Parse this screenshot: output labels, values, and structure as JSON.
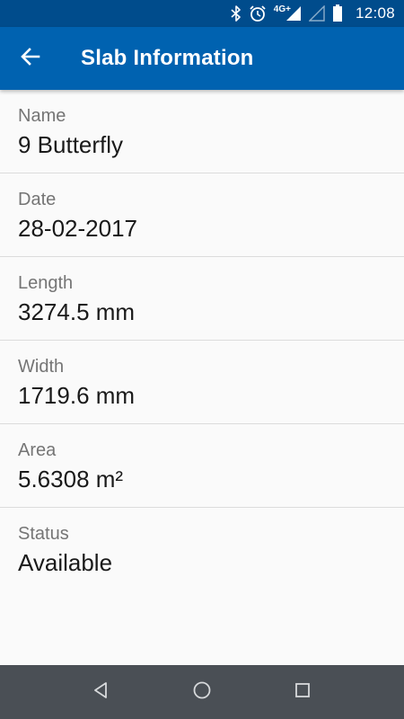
{
  "status_bar": {
    "network_type": "4G+",
    "time": "12:08",
    "icons": [
      "bluetooth-icon",
      "alarm-icon",
      "signal-icon",
      "signal-empty-icon",
      "battery-icon"
    ]
  },
  "app_bar": {
    "title": "Slab Information",
    "back_icon": "arrow-back-icon"
  },
  "fields": [
    {
      "label": "Name",
      "value": "9 Butterfly"
    },
    {
      "label": "Date",
      "value": "28-02-2017"
    },
    {
      "label": "Length",
      "value": "3274.5 mm"
    },
    {
      "label": "Width",
      "value": "1719.6 mm"
    },
    {
      "label": "Area",
      "value": "5.6308 m²"
    },
    {
      "label": "Status",
      "value": "Available"
    }
  ],
  "nav_bar": {
    "buttons": [
      "back-triangle-icon",
      "home-circle-icon",
      "recents-square-icon"
    ]
  },
  "colors": {
    "status_bar": "#004c8c",
    "app_bar": "#0062b0",
    "background": "#fafafa",
    "label": "#757575",
    "value": "#1a1a1a",
    "nav_bar": "#4a4f55"
  }
}
